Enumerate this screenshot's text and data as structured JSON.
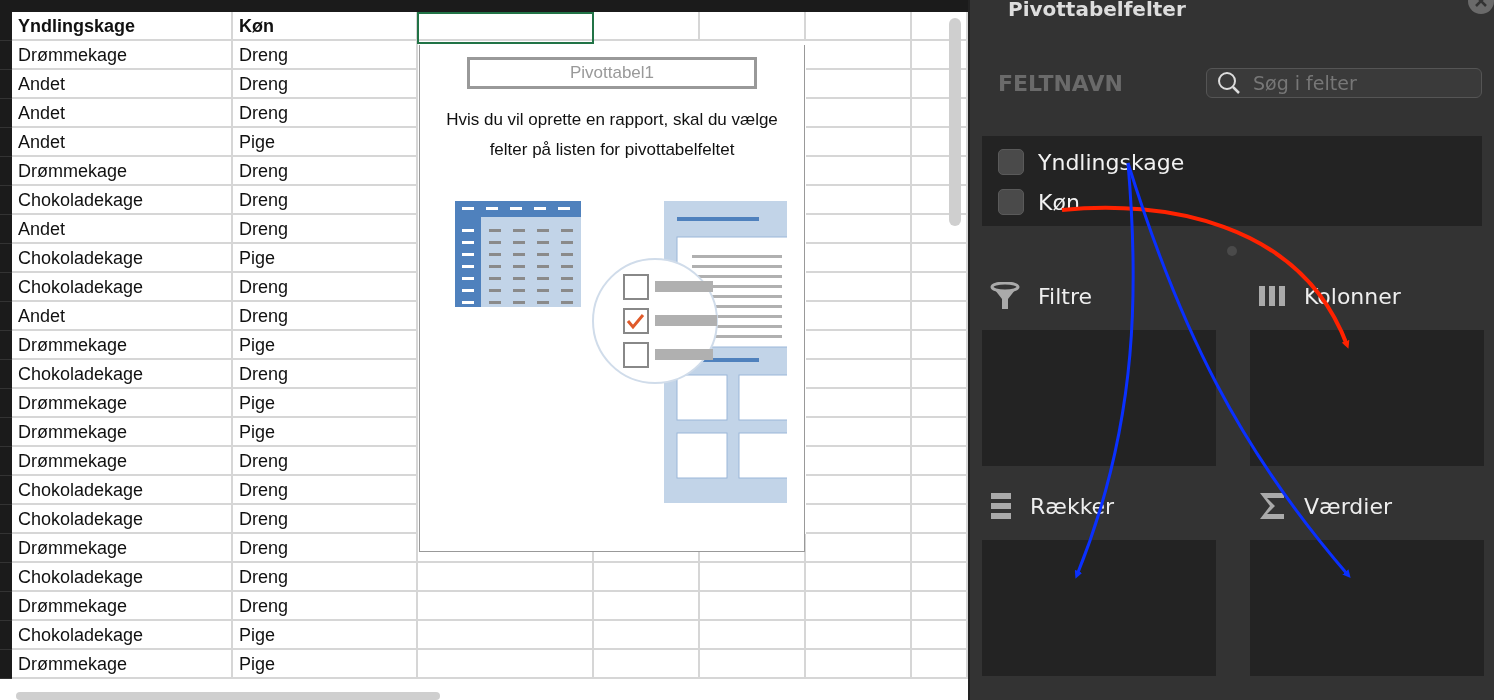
{
  "sheet": {
    "columns": [
      {
        "header": "Yndlingskage"
      },
      {
        "header": "Køn"
      }
    ],
    "rows": [
      [
        "Drømmekage",
        "Dreng"
      ],
      [
        "Andet",
        "Dreng"
      ],
      [
        "Andet",
        "Dreng"
      ],
      [
        "Andet",
        "Pige"
      ],
      [
        "Drømmekage",
        "Dreng"
      ],
      [
        "Chokoladekage",
        "Dreng"
      ],
      [
        "Andet",
        "Dreng"
      ],
      [
        "Chokoladekage",
        "Pige"
      ],
      [
        "Chokoladekage",
        "Dreng"
      ],
      [
        "Andet",
        "Dreng"
      ],
      [
        "Drømmekage",
        "Pige"
      ],
      [
        "Chokoladekage",
        "Dreng"
      ],
      [
        "Drømmekage",
        "Pige"
      ],
      [
        "Drømmekage",
        "Pige"
      ],
      [
        "Drømmekage",
        "Dreng"
      ],
      [
        "Chokoladekage",
        "Dreng"
      ],
      [
        "Chokoladekage",
        "Dreng"
      ],
      [
        "Drømmekage",
        "Dreng"
      ],
      [
        "Chokoladekage",
        "Dreng"
      ],
      [
        "Drømmekage",
        "Dreng"
      ],
      [
        "Chokoladekage",
        "Pige"
      ],
      [
        "Drømmekage",
        "Pige"
      ]
    ]
  },
  "pivot_placeholder": {
    "name": "Pivottabel1",
    "message": "Hvis du vil oprette en rapport, skal du vælge felter på listen for pivottabelfeltet"
  },
  "panel": {
    "title": "Pivottabelfelter",
    "field_header": "FELTNAVN",
    "search": {
      "placeholder": "Søg i felter"
    },
    "fields": [
      {
        "label": "Yndlingskage",
        "checked": false
      },
      {
        "label": "Køn",
        "checked": false
      }
    ],
    "areas": [
      {
        "kind": "filter",
        "label": "Filtre"
      },
      {
        "kind": "columns",
        "label": "Kolonner"
      },
      {
        "kind": "rows",
        "label": "Rækker"
      },
      {
        "kind": "values",
        "label": "Værdier"
      }
    ]
  }
}
